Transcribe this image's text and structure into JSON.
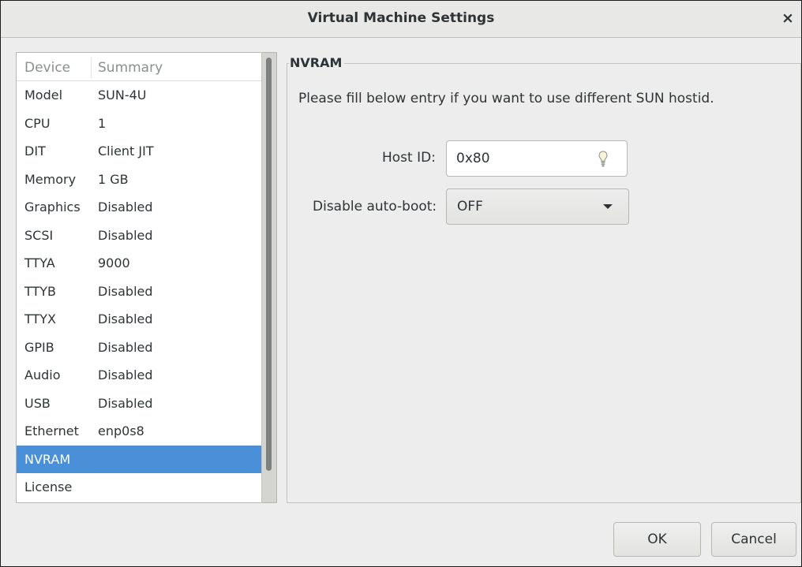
{
  "window": {
    "title": "Virtual Machine Settings",
    "close_glyph": "×"
  },
  "device_list": {
    "columns": [
      "Device",
      "Summary"
    ],
    "rows": [
      {
        "device": "Model",
        "summary": "SUN-4U"
      },
      {
        "device": "CPU",
        "summary": "1"
      },
      {
        "device": "DIT",
        "summary": "Client JIT"
      },
      {
        "device": "Memory",
        "summary": "1 GB"
      },
      {
        "device": "Graphics",
        "summary": "Disabled"
      },
      {
        "device": "SCSI",
        "summary": "Disabled"
      },
      {
        "device": "TTYA",
        "summary": "9000"
      },
      {
        "device": "TTYB",
        "summary": "Disabled"
      },
      {
        "device": "TTYX",
        "summary": "Disabled"
      },
      {
        "device": "GPIB",
        "summary": "Disabled"
      },
      {
        "device": "Audio",
        "summary": "Disabled"
      },
      {
        "device": "USB",
        "summary": "Disabled"
      },
      {
        "device": "Ethernet",
        "summary": "enp0s8"
      },
      {
        "device": "NVRAM",
        "summary": ""
      },
      {
        "device": "License",
        "summary": ""
      }
    ],
    "selected_device": "NVRAM"
  },
  "nvram": {
    "section_title": "NVRAM",
    "instruction": "Please fill below entry if you want to use different SUN hostid.",
    "host_id_label": "Host ID:",
    "host_id_value": "0x80",
    "host_id_icon": "lightbulb-icon",
    "autoboot_label": "Disable auto-boot:",
    "autoboot_value": "OFF",
    "autoboot_icon": "chevron-down-icon"
  },
  "buttons": {
    "ok": "OK",
    "cancel": "Cancel"
  },
  "colors": {
    "selection": "#4a90d9",
    "window_bg": "#ededed",
    "text": "#2e3436"
  }
}
